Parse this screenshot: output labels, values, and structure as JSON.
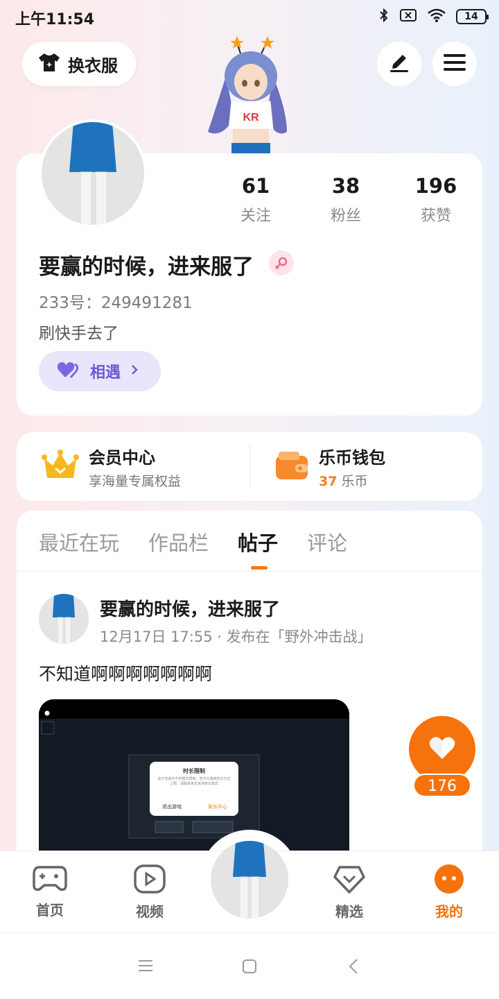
{
  "status_bar": {
    "time": "上午11:54",
    "battery": "14"
  },
  "header": {
    "outfit_label": "换衣服",
    "edit_icon": "edit-icon",
    "menu_icon": "menu-icon"
  },
  "profile": {
    "stats": [
      {
        "value": "61",
        "label": "关注"
      },
      {
        "value": "38",
        "label": "粉丝"
      },
      {
        "value": "196",
        "label": "获赞"
      }
    ],
    "username": "要赢的时候，进来服了",
    "gender": "female",
    "user_id": "233号：249491281",
    "bio": "刷快手去了",
    "meet_label": "相遇"
  },
  "vip": {
    "member_title": "会员中心",
    "member_sub": "享海量专属权益",
    "wallet_title": "乐币钱包",
    "coin_amount": "37",
    "coin_unit": "乐币"
  },
  "tabs": [
    "最近在玩",
    "作品栏",
    "帖子",
    "评论"
  ],
  "active_tab": "帖子",
  "post": {
    "author": "要赢的时候，进来服了",
    "meta": "12月17日 17:55 · 发布在「野外冲击战」",
    "text": "不知道啊啊啊啊啊啊啊",
    "dialog_title": "时长限制",
    "dialog_body": "由于您家长守护模式限制，您今日游戏时长已达上限，请联系家长关闭家长模式",
    "dialog_left": "退出游戏",
    "dialog_right": "家长中心"
  },
  "like": {
    "count": "176"
  },
  "bottom_nav": [
    {
      "label": "首页",
      "icon": "gamepad-icon"
    },
    {
      "label": "视频",
      "icon": "play-icon"
    },
    {
      "label": "精选",
      "icon": "heart-diamond-icon"
    },
    {
      "label": "我的",
      "icon": "face-icon"
    }
  ],
  "colors": {
    "accent": "#f5720c",
    "meet": "#6a5ad8",
    "background_left": "#fde9ea",
    "background_right": "#e8f1fb"
  }
}
